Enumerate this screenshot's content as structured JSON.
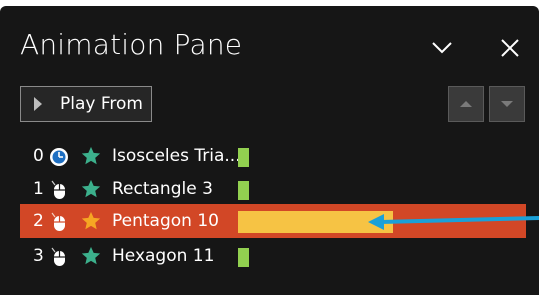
{
  "pane": {
    "title": "Animation Pane",
    "collapse_icon": "chevron-down-icon",
    "close_icon": "close-icon"
  },
  "toolbar": {
    "play_from_label": "Play From",
    "move_up_icon": "move-up-icon",
    "move_down_icon": "move-down-icon"
  },
  "animations": [
    {
      "index": "0",
      "trigger": "clock-icon",
      "effect": "emphasis-star",
      "name": "Isosceles Tria...",
      "selected": false
    },
    {
      "index": "1",
      "trigger": "mouse-click-icon",
      "effect": "emphasis-star",
      "name": "Rectangle 3",
      "selected": false
    },
    {
      "index": "2",
      "trigger": "mouse-click-icon",
      "effect": "emphasis-star",
      "name": "Pentagon 10",
      "selected": true
    },
    {
      "index": "3",
      "trigger": "mouse-click-icon",
      "effect": "emphasis-star",
      "name": "Hexagon 11",
      "selected": false
    }
  ],
  "colors": {
    "background": "#161616",
    "selected_row": "#d24726",
    "timing_bar": "#92d050",
    "selected_timing_bar": "#f6c344",
    "effect_star": "#3cb08c",
    "selected_star": "#f6a623",
    "callout_arrow": "#1aa0d8"
  }
}
